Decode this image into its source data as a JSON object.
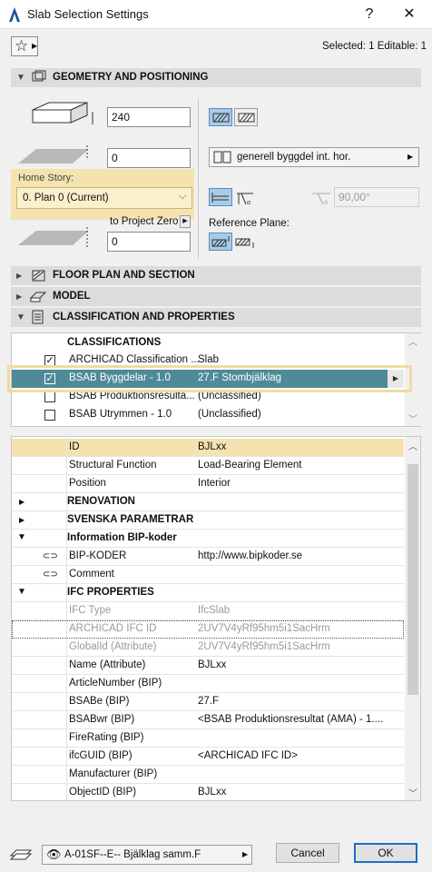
{
  "window": {
    "title": "Slab Selection Settings",
    "help": "?",
    "close": "✕"
  },
  "header": {
    "selected_info": "Selected: 1 Editable: 1"
  },
  "geometry": {
    "section_label": "GEOMETRY AND POSITIONING",
    "thickness": "240",
    "offset": "0",
    "home_story_label": "Home Story:",
    "home_story_value": "0. Plan 0 (Current)",
    "to_project_zero_label": "to Project Zero",
    "project_zero_value": "0",
    "material_value": "generell byggdel int. hor.",
    "angle_value": "90,00°",
    "reference_plane_label": "Reference Plane:"
  },
  "sections": {
    "floor_plan": "FLOOR PLAN AND SECTION",
    "model": "MODEL",
    "classification": "CLASSIFICATION AND PROPERTIES"
  },
  "classifications": {
    "header": "CLASSIFICATIONS",
    "rows": [
      {
        "name": "ARCHICAD Classification ...",
        "value": "Slab",
        "checked": true
      },
      {
        "name": "BSAB Byggdelar - 1.0",
        "value": "27.F Stombjälklag",
        "checked": true
      },
      {
        "name": "BSAB Produktionsresulta...",
        "value": "(Unclassified)",
        "checked": false
      },
      {
        "name": "BSAB Utrymmen - 1.0",
        "value": "(Unclassified)",
        "checked": false
      }
    ]
  },
  "properties": {
    "rows": [
      {
        "name": "ID",
        "value": "BJLxx"
      },
      {
        "name": "Structural Function",
        "value": "Load-Bearing Element"
      },
      {
        "name": "Position",
        "value": "Interior"
      },
      {
        "name": "RENOVATION",
        "value": ""
      },
      {
        "name": "SVENSKA PARAMETRAR",
        "value": ""
      },
      {
        "name": "Information BIP-koder",
        "value": ""
      },
      {
        "name": "BIP-KODER",
        "value": "http://www.bipkoder.se"
      },
      {
        "name": "Comment",
        "value": ""
      },
      {
        "name": "IFC PROPERTIES",
        "value": ""
      },
      {
        "name": "IFC Type",
        "value": "IfcSlab"
      },
      {
        "name": "ARCHICAD IFC ID",
        "value": "2UV7V4yRf95hm5i1SacHrm"
      },
      {
        "name": "GlobalId (Attribute)",
        "value": "2UV7V4yRf95hm5i1SacHrm"
      },
      {
        "name": "Name (Attribute)",
        "value": "BJLxx"
      },
      {
        "name": "ArticleNumber (BIP)",
        "value": ""
      },
      {
        "name": "BSABe (BIP)",
        "value": "27.F"
      },
      {
        "name": "BSABwr (BIP)",
        "value": "<BSAB Produktionsresultat (AMA) - 1...."
      },
      {
        "name": "FireRating (BIP)",
        "value": ""
      },
      {
        "name": "ifcGUID (BIP)",
        "value": "<ARCHICAD IFC ID>"
      },
      {
        "name": "Manufacturer (BIP)",
        "value": ""
      },
      {
        "name": "ObjectID (BIP)",
        "value": "BJLxx"
      }
    ]
  },
  "footer": {
    "layer": "A-01SF--E-- Bjälklag samm.F",
    "cancel": "Cancel",
    "ok": "OK"
  }
}
